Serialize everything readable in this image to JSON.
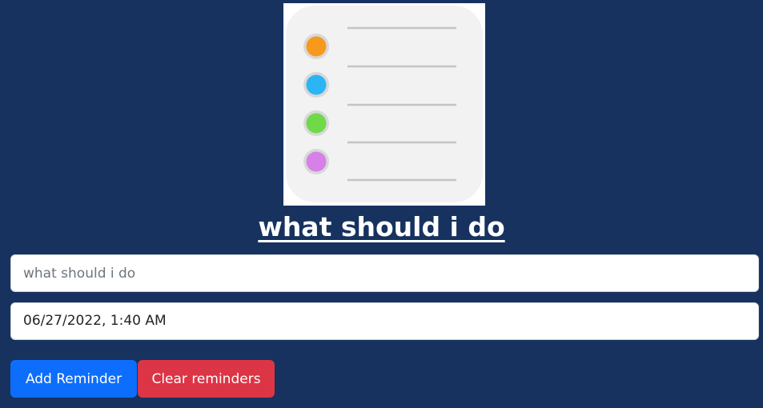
{
  "app": {
    "title": "what should i do",
    "logo_icon": "reminders-list-icon"
  },
  "form": {
    "task_placeholder": "what should i do",
    "task_value": "",
    "datetime_value": "06/27/2022, 1:40 AM"
  },
  "actions": {
    "add_label": "Add Reminder",
    "clear_label": "Clear reminders"
  },
  "colors": {
    "background": "#17325f",
    "add_button": "#0d6efd",
    "clear_button": "#dc3545",
    "dot_orange": "#f7991c",
    "dot_blue": "#2bb5f5",
    "dot_green": "#6fd94a",
    "dot_purple": "#d680e8"
  }
}
